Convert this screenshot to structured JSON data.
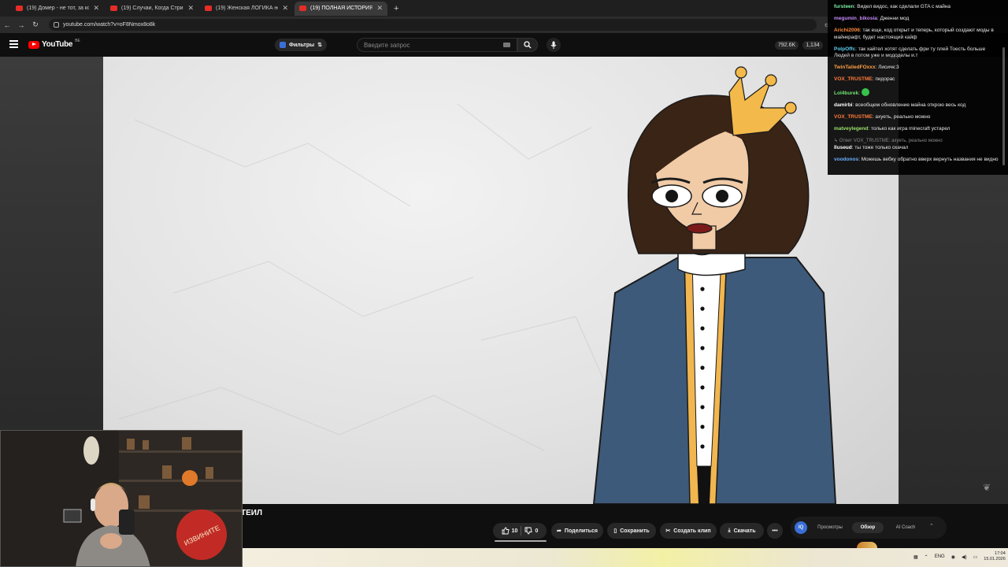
{
  "browser": {
    "tabs": [
      {
        "label": "(19) Домер - не тот, за кого се"
      },
      {
        "label": "(19) Случаи, Когда Стримеры"
      },
      {
        "label": "(19) Женская ЛОГИКА не пер"
      },
      {
        "label": "(19) ПОЛНАЯ ИСТОРИЯ СМЕ"
      }
    ],
    "new_tab": "+",
    "url": "youtube.com/watch?v=oF8Nmox8o8k"
  },
  "youtube": {
    "logo_text": "YouTube",
    "country_code": "BE",
    "filters_label": "Фильтры",
    "search_placeholder": "Введите запрос",
    "stats": [
      "792.6K",
      "1,134"
    ]
  },
  "chat": {
    "messages": [
      {
        "user": "fursteen",
        "color": "#7cf0a4",
        "text": "Видел видос, как сделали GTA с майна"
      },
      {
        "user": "megumin_bikosia",
        "color": "#c58af9",
        "text": "Дженни мод"
      },
      {
        "user": "Arichi2006",
        "color": "#ff8c3a",
        "text": "так еще, код открыт и теперь, который создают моды в майнкрафт, будет настоящий кайф"
      },
      {
        "user": "PolpOffc",
        "color": "#5fd3f3",
        "text": "так хайтел хотят сделать фри ту плей Тоесть больше Людей в потом уже и мододелы и.т"
      },
      {
        "user": "TwinTailedFOxxx",
        "color": "#ff9f43",
        "text": "Лисичк:3"
      },
      {
        "user": "VOX_TRUSTME",
        "color": "#ff7b3a",
        "text": "пидорас"
      },
      {
        "user": "Lol4burek",
        "color": "#6ee36e",
        "text": ""
      },
      {
        "user": "damirbi",
        "color": "#ffffff",
        "text": "всеобщем обновление майна открою весь код"
      },
      {
        "user": "VOX_TRUSTME",
        "color": "#ff7b3a",
        "text": "ахуеть, реально можно"
      },
      {
        "user": "matveylegend",
        "color": "#9be36b",
        "text": "только как игра minecraft устарел"
      },
      {
        "user": "Iluseud",
        "color": "#ffffff",
        "text": "ты тоже только скачал",
        "reply_to": "Ответ VOX_TRUSTME: ахуеть, реально можно"
      },
      {
        "user": "voodonos",
        "color": "#6ab0ff",
        "text": "Можешь вебку обратно вверх вернуть названия не видно"
      }
    ]
  },
  "video": {
    "title_visible": "ТЕИЛ",
    "like_count": "10",
    "dislike_count": "0",
    "actions": {
      "share": "Поделиться",
      "save": "Сохранить",
      "clip": "Создать клип",
      "download": "Скачать"
    }
  },
  "rating_extension": {
    "tabs": [
      "Просмотры",
      "Обзор",
      "AI Coach"
    ]
  },
  "system": {
    "language": "ENG",
    "time": "17:04",
    "date": "15.01.2026"
  }
}
